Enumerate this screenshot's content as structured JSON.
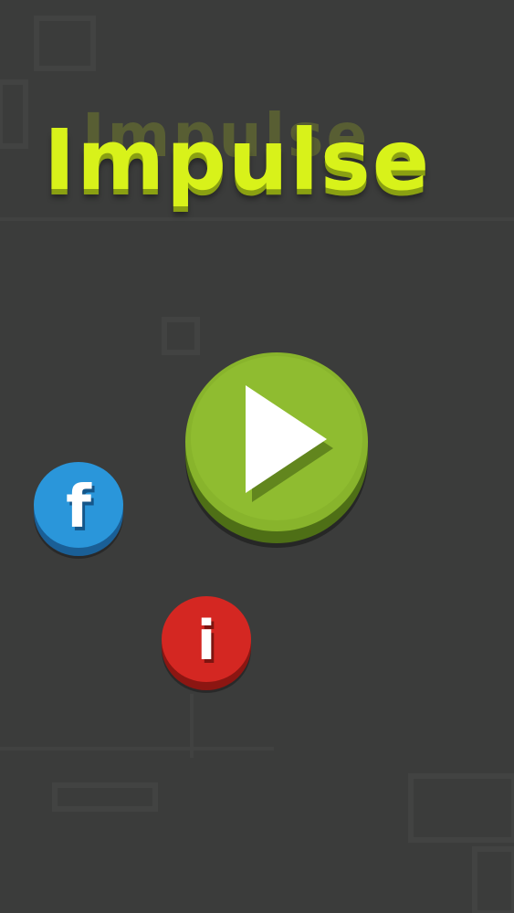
{
  "game": {
    "title": "Impulse"
  },
  "buttons": {
    "play": {
      "icon": "play-icon",
      "color": "#88b42c"
    },
    "facebook": {
      "icon": "facebook-icon",
      "glyph": "f",
      "color": "#2a96da"
    },
    "info": {
      "icon": "info-icon",
      "glyph": "i",
      "color": "#d42722"
    }
  },
  "colors": {
    "background": "#3b3c3b",
    "title": "#d8f21a"
  }
}
